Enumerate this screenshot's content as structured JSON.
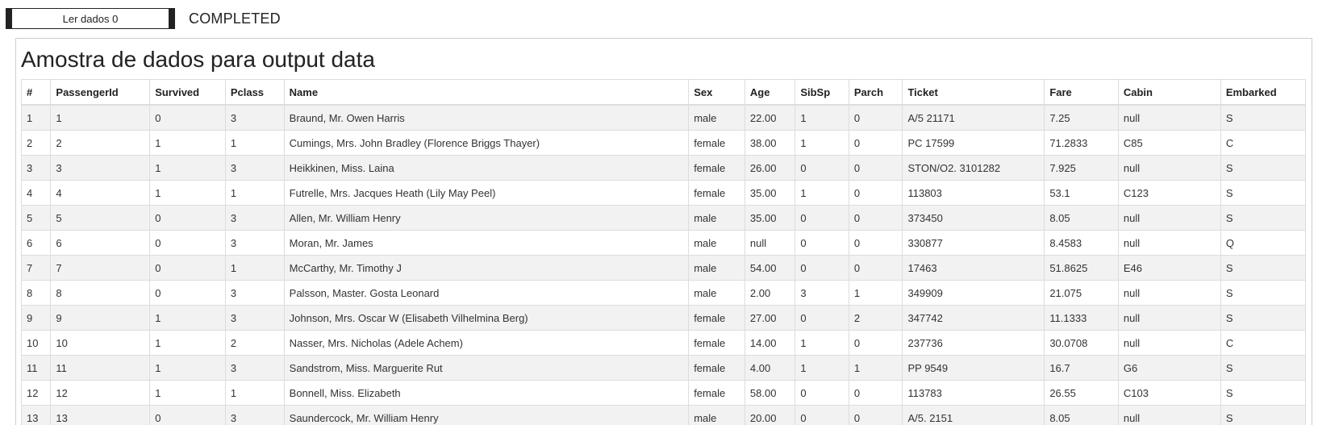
{
  "toolbar": {
    "read_button_label": "Ler dados 0",
    "status": "COMPLETED"
  },
  "panel": {
    "title": "Amostra de dados para output data"
  },
  "table": {
    "columns": [
      "#",
      "PassengerId",
      "Survived",
      "Pclass",
      "Name",
      "Sex",
      "Age",
      "SibSp",
      "Parch",
      "Ticket",
      "Fare",
      "Cabin",
      "Embarked"
    ],
    "rows": [
      [
        "1",
        "1",
        "0",
        "3",
        "Braund, Mr. Owen Harris",
        "male",
        "22.00",
        "1",
        "0",
        "A/5 21171",
        "7.25",
        "null",
        "S"
      ],
      [
        "2",
        "2",
        "1",
        "1",
        "Cumings, Mrs. John Bradley (Florence Briggs Thayer)",
        "female",
        "38.00",
        "1",
        "0",
        "PC 17599",
        "71.2833",
        "C85",
        "C"
      ],
      [
        "3",
        "3",
        "1",
        "3",
        "Heikkinen, Miss. Laina",
        "female",
        "26.00",
        "0",
        "0",
        "STON/O2. 3101282",
        "7.925",
        "null",
        "S"
      ],
      [
        "4",
        "4",
        "1",
        "1",
        "Futrelle, Mrs. Jacques Heath (Lily May Peel)",
        "female",
        "35.00",
        "1",
        "0",
        "113803",
        "53.1",
        "C123",
        "S"
      ],
      [
        "5",
        "5",
        "0",
        "3",
        "Allen, Mr. William Henry",
        "male",
        "35.00",
        "0",
        "0",
        "373450",
        "8.05",
        "null",
        "S"
      ],
      [
        "6",
        "6",
        "0",
        "3",
        "Moran, Mr. James",
        "male",
        "null",
        "0",
        "0",
        "330877",
        "8.4583",
        "null",
        "Q"
      ],
      [
        "7",
        "7",
        "0",
        "1",
        "McCarthy, Mr. Timothy J",
        "male",
        "54.00",
        "0",
        "0",
        "17463",
        "51.8625",
        "E46",
        "S"
      ],
      [
        "8",
        "8",
        "0",
        "3",
        "Palsson, Master. Gosta Leonard",
        "male",
        "2.00",
        "3",
        "1",
        "349909",
        "21.075",
        "null",
        "S"
      ],
      [
        "9",
        "9",
        "1",
        "3",
        "Johnson, Mrs. Oscar W (Elisabeth Vilhelmina Berg)",
        "female",
        "27.00",
        "0",
        "2",
        "347742",
        "11.1333",
        "null",
        "S"
      ],
      [
        "10",
        "10",
        "1",
        "2",
        "Nasser, Mrs. Nicholas (Adele Achem)",
        "female",
        "14.00",
        "1",
        "0",
        "237736",
        "30.0708",
        "null",
        "C"
      ],
      [
        "11",
        "11",
        "1",
        "3",
        "Sandstrom, Miss. Marguerite Rut",
        "female",
        "4.00",
        "1",
        "1",
        "PP 9549",
        "16.7",
        "G6",
        "S"
      ],
      [
        "12",
        "12",
        "1",
        "1",
        "Bonnell, Miss. Elizabeth",
        "female",
        "58.00",
        "0",
        "0",
        "113783",
        "26.55",
        "C103",
        "S"
      ],
      [
        "13",
        "13",
        "0",
        "3",
        "Saundercock, Mr. William Henry",
        "male",
        "20.00",
        "0",
        "0",
        "A/5. 2151",
        "8.05",
        "null",
        "S"
      ]
    ]
  }
}
